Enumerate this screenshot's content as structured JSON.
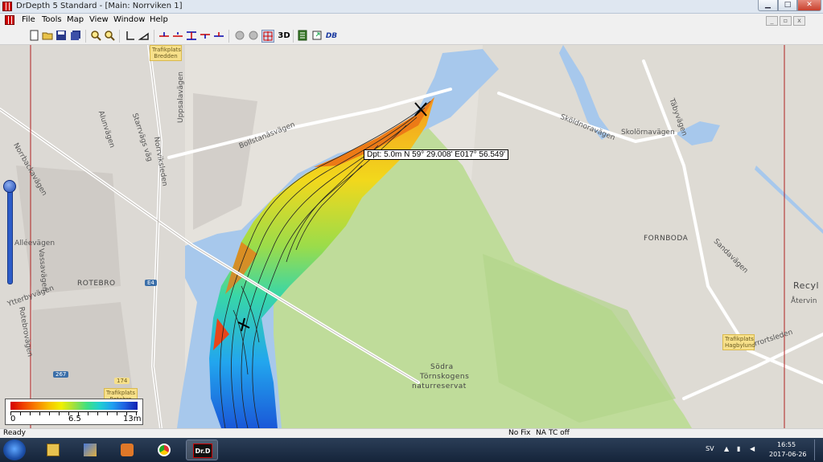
{
  "window": {
    "title": "DrDepth 5 Standard - [Main: Norrviken 1]",
    "minimize_glyph": "▁",
    "maximize_glyph": "□",
    "close_glyph": "✕"
  },
  "menubar": {
    "items": [
      "File",
      "Tools",
      "Map",
      "View",
      "Window",
      "Help"
    ]
  },
  "toolbar": {
    "three_d_label": "3D",
    "db_label": "DB",
    "icons": [
      "new-icon",
      "open-icon",
      "save-icon",
      "save-all-icon",
      "zoom-in-icon",
      "zoom-out-icon",
      "ruler-icon",
      "area-icon",
      "track-tool-icons",
      "depth-tool-icons",
      "globe-icon",
      "grid-icon",
      "3d-icon",
      "table-icon",
      "export-icon",
      "database-icon"
    ]
  },
  "map": {
    "depth_readout": "Dpt: 5.0m N 59° 29.008' E017° 56.549'",
    "street_labels": [
      "Uppsalavägen",
      "Bollstanäsvägen",
      "Skolörnavägen",
      "Sköldnoravägen",
      "Täbyvägen",
      "Norrviksleden",
      "Norrortsleden",
      "Sandavägen",
      "Alléevägen",
      "Vassavägen",
      "Ytterbyvägen",
      "Strandvägen",
      "Alunvägen",
      "Starrvägs väg",
      "Norrbackavägen",
      "Rotebrovägen",
      "Norrviksvägen",
      "Återvin"
    ],
    "place_labels": [
      "ROTEBRO",
      "FORNBODA",
      "Södra",
      "Törnskogens",
      "naturreservat",
      "Recyl"
    ],
    "signs": [
      {
        "text": "Trafikplats Bredden"
      },
      {
        "text": "Trafikplats Hagbylund"
      },
      {
        "text": "Trafikplats Rotebro"
      }
    ],
    "shields": [
      "E4",
      "267",
      "174"
    ]
  },
  "legend": {
    "min_label": "0",
    "mid_label": "6.5",
    "max_label": "13m",
    "colors": [
      "#d40000",
      "#f88000",
      "#f0f000",
      "#40e080",
      "#20a0f0",
      "#1020b0"
    ]
  },
  "statusbar": {
    "ready": "Ready",
    "fix": "No Fix",
    "na": "NA",
    "tc": "TC off"
  },
  "taskbar": {
    "apps": [
      "windows-explorer-icon",
      "paint-icon",
      "media-player-icon",
      "chrome-icon",
      "drdepth-icon"
    ],
    "active_app_label": "Dr.D",
    "language": "SV",
    "time": "16:55",
    "date": "2017-06-26"
  }
}
